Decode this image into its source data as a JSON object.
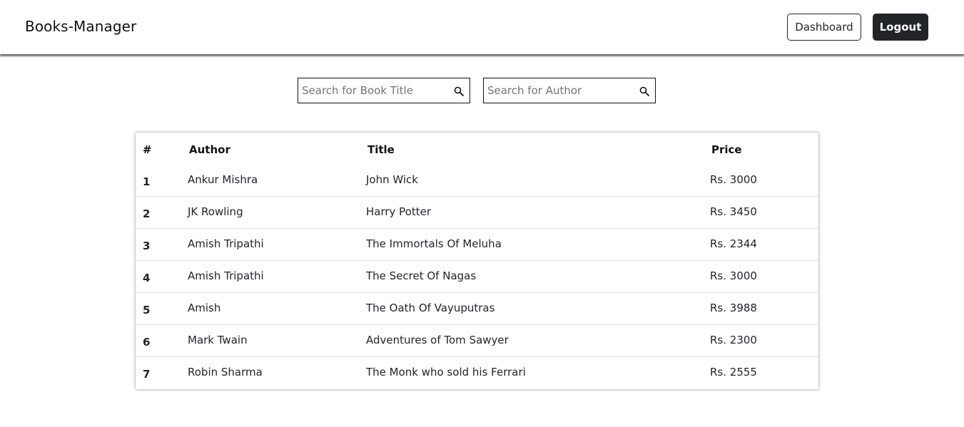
{
  "navbar": {
    "brand": "Books-Manager",
    "dashboard_label": "Dashboard",
    "logout_label": "Logout"
  },
  "search": {
    "title_placeholder": "Search for Book Title",
    "author_placeholder": "Search for Author",
    "icon": "search-icon"
  },
  "table": {
    "headers": {
      "num": "#",
      "author": "Author",
      "title": "Title",
      "price": "Price"
    },
    "rows": [
      {
        "num": "1",
        "author": "Ankur Mishra",
        "title": "John Wick",
        "price": "Rs. 3000"
      },
      {
        "num": "2",
        "author": "JK Rowling",
        "title": "Harry Potter",
        "price": "Rs. 3450"
      },
      {
        "num": "3",
        "author": "Amish Tripathi",
        "title": "The Immortals Of Meluha",
        "price": "Rs. 2344"
      },
      {
        "num": "4",
        "author": "Amish Tripathi",
        "title": "The Secret Of Nagas",
        "price": "Rs. 3000"
      },
      {
        "num": "5",
        "author": "Amish",
        "title": "The Oath Of Vayuputras",
        "price": "Rs. 3988"
      },
      {
        "num": "6",
        "author": "Mark Twain",
        "title": "Adventures of Tom Sawyer",
        "price": "Rs. 2300"
      },
      {
        "num": "7",
        "author": "Robin Sharma",
        "title": "The Monk who sold his Ferrari",
        "price": "Rs. 2555"
      }
    ]
  },
  "colors": {
    "dark": "#212529",
    "border": "#dee2e6",
    "background": "#ffffff"
  }
}
